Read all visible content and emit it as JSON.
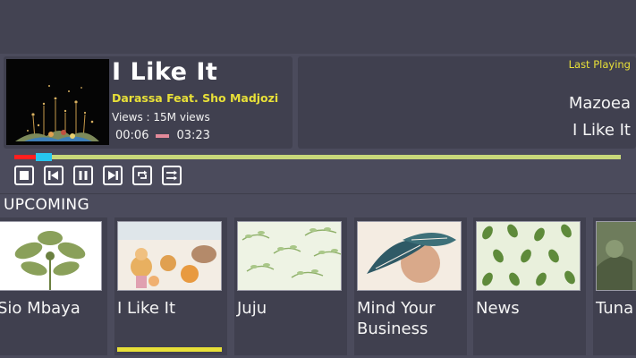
{
  "now_playing": {
    "title": "I Like It",
    "artist": "Darassa Feat. Sho Madjozi",
    "views": "Views : 15M views",
    "elapsed": "00:06",
    "duration": "03:23"
  },
  "last_playing": {
    "label": "Last Playing",
    "artist": "Mazoea",
    "title": "I Like It"
  },
  "progress": {
    "played_fraction": 0.03
  },
  "controls": [
    {
      "name": "stop-icon"
    },
    {
      "name": "previous-icon"
    },
    {
      "name": "pause-icon"
    },
    {
      "name": "next-icon"
    },
    {
      "name": "repeat-icon"
    },
    {
      "name": "shuffle-icon"
    }
  ],
  "upcoming": {
    "heading": "UPCOMING",
    "items": [
      {
        "label": "Sio Mbaya"
      },
      {
        "label": "I Like It",
        "selected": true
      },
      {
        "label": "Juju"
      },
      {
        "label": "Mind Your Business"
      },
      {
        "label": "News"
      },
      {
        "label": "Tuna"
      }
    ]
  },
  "colors": {
    "accent_yellow": "#e8e038",
    "progress_played": "#ff1f1f",
    "progress_knob": "#27c6ef",
    "progress_track": "#c8d87a"
  }
}
